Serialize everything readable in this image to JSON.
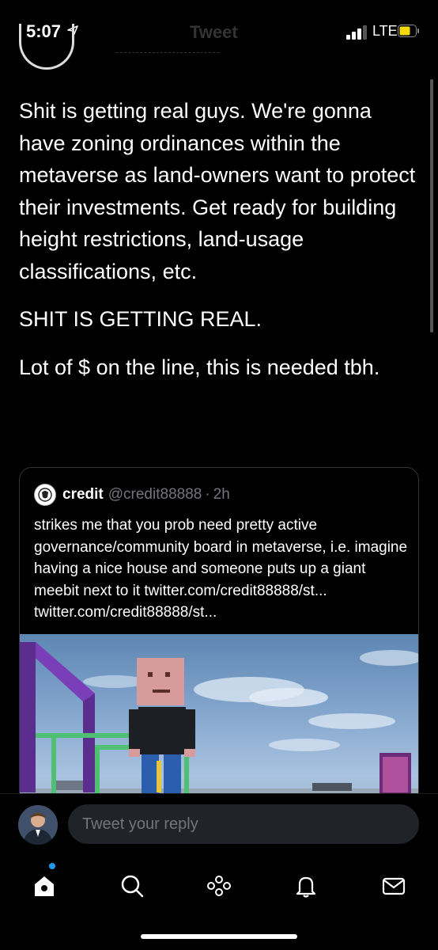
{
  "status_bar": {
    "time": "5:07",
    "network": "LTE",
    "ghost_title": "Tweet"
  },
  "tweet": {
    "paragraphs": [
      "Shit is getting real guys.  We're gonna have zoning ordinances within the metaverse as land-owners want to protect their investments. Get ready for building height restrictions, land-usage classifications, etc.",
      "SHIT IS GETTING REAL.",
      "Lot of $ on the line, this is needed tbh."
    ]
  },
  "quote": {
    "name": "credit",
    "handle": "@credit88888",
    "separator": "·",
    "time": "2h",
    "text": "strikes me that you prob need pretty active governance/community board in metaverse, i.e. imagine having a nice house and someone puts up a giant meebit next to it twitter.com/credit88888/st... twitter.com/credit88888/st..."
  },
  "reply": {
    "placeholder": "Tweet your reply"
  },
  "tabs": [
    {
      "icon": "home-icon"
    },
    {
      "icon": "search-icon"
    },
    {
      "icon": "spaces-icon"
    },
    {
      "icon": "notifications-icon"
    },
    {
      "icon": "messages-icon"
    }
  ],
  "colors": {
    "background": "#000000",
    "text": "#ffffff",
    "secondary": "#71767b",
    "accent": "#1d9bf0",
    "input_bg": "#202327"
  }
}
